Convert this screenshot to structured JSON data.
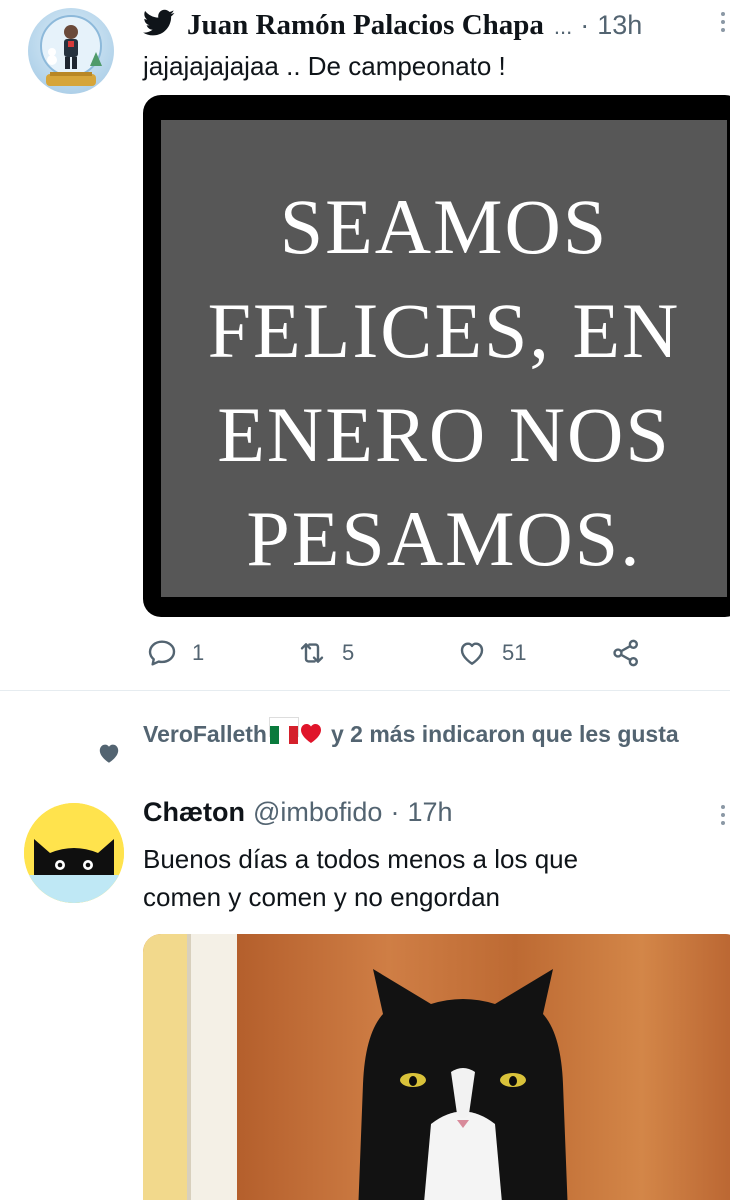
{
  "tweet1": {
    "author_name": "Juan Ramón Palacios Chapa",
    "ellipsis": "...",
    "separator": "·",
    "time": "13h",
    "text": "jajajajajajaa .. De campeonato !",
    "media_quote": [
      "SEAMOS",
      "FELICES, EN",
      "ENERO NOS",
      "PESAMOS."
    ],
    "actions": {
      "reply_count": "1",
      "retweet_count": "5",
      "like_count": "51"
    }
  },
  "social_context": {
    "user": "VeroFalleth",
    "text": "y 2 más indicaron que les gusta"
  },
  "tweet2": {
    "author_name": "Chæton",
    "handle": "@imbofido",
    "separator": "·",
    "time": "17h",
    "text_line1": "Buenos días a todos menos a los que",
    "text_line2": "comen y comen y no engordan"
  },
  "colors": {
    "text_primary": "#0f1419",
    "text_secondary": "#536471",
    "divider": "#e6ecf0",
    "avatar2_bg": "#ffe34d"
  },
  "icons": [
    "twitter-bird-icon",
    "more-icon",
    "reply-icon",
    "retweet-icon",
    "like-icon",
    "share-icon",
    "liked-heart-icon",
    "mexico-flag-icon",
    "red-heart-icon"
  ]
}
